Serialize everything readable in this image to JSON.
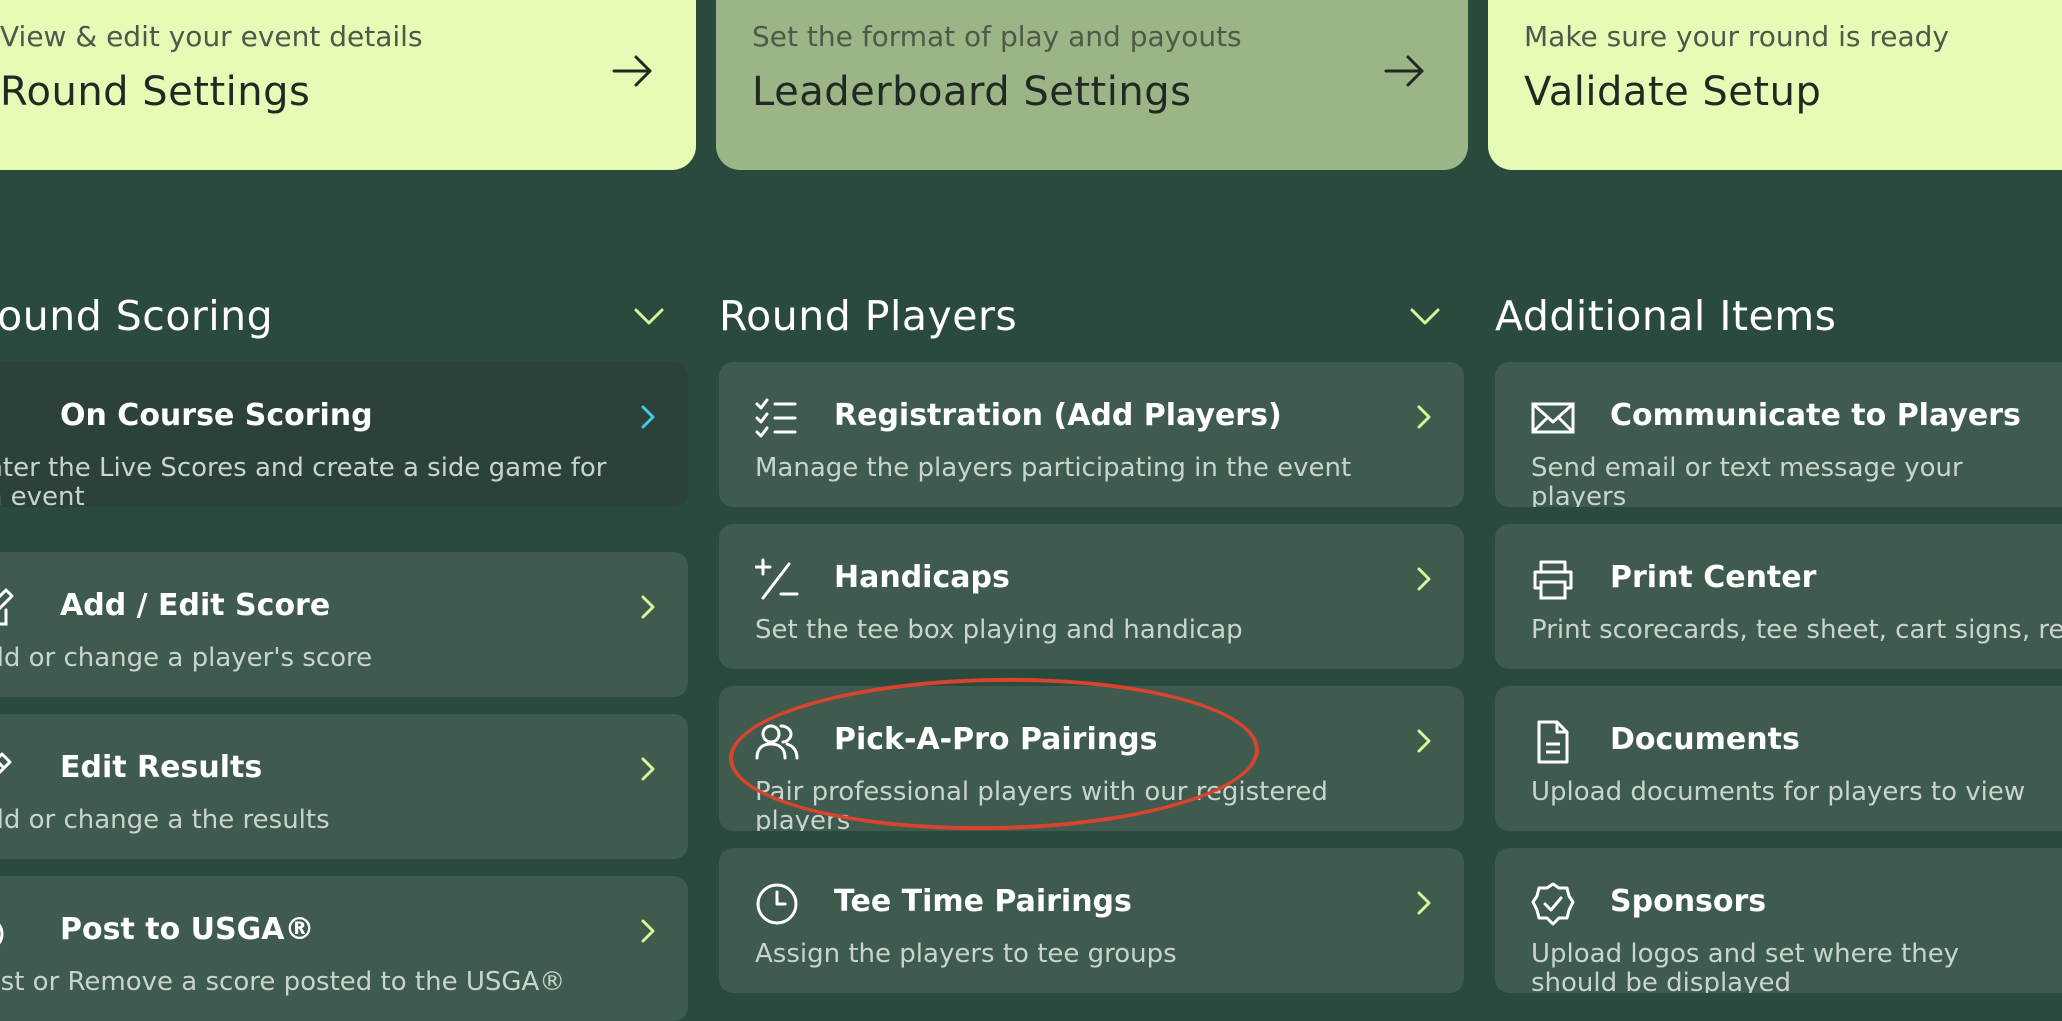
{
  "top_cards": [
    {
      "subtitle": "View & edit your event details",
      "title": "Round Settings"
    },
    {
      "subtitle": "Set the format of play and payouts",
      "title": "Leaderboard Settings"
    },
    {
      "subtitle": "Make sure your round is ready",
      "title": "Validate Setup"
    }
  ],
  "sections": [
    {
      "title": "Round Scoring",
      "items": [
        {
          "icon": "list-icon",
          "title": "On Course Scoring",
          "desc": "Enter the Live Scores and create a side game for an event"
        },
        {
          "icon": "edit-icon",
          "title": "Add / Edit Score",
          "desc": "Add or change a player's score"
        },
        {
          "icon": "pencil-icon",
          "title": "Edit Results",
          "desc": "Add or change a the results"
        },
        {
          "icon": "upload-icon",
          "title": "Post to USGA®",
          "desc": "Post or Remove a score posted to the USGA®"
        }
      ]
    },
    {
      "title": "Round Players",
      "items": [
        {
          "icon": "checklist-icon",
          "title": "Registration (Add Players)",
          "desc": "Manage the players participating in the event"
        },
        {
          "icon": "plus-minus-icon",
          "title": "Handicaps",
          "desc": "Set the tee box playing and handicap"
        },
        {
          "icon": "users-icon",
          "title": "Pick-A-Pro Pairings",
          "desc": "Pair professional players with our registered players"
        },
        {
          "icon": "clock-icon",
          "title": "Tee Time Pairings",
          "desc": "Assign the players to tee groups"
        }
      ]
    },
    {
      "title": "Additional Items",
      "items": [
        {
          "icon": "mail-icon",
          "title": "Communicate to Players",
          "desc": "Send email or text message your players"
        },
        {
          "icon": "printer-icon",
          "title": "Print Center",
          "desc": "Print scorecards, tee sheet, cart signs, results"
        },
        {
          "icon": "document-icon",
          "title": "Documents",
          "desc": "Upload documents for players to view"
        },
        {
          "icon": "badge-check-icon",
          "title": "Sponsors",
          "desc": "Upload logos and set where they should be displayed"
        }
      ]
    }
  ],
  "colors": {
    "accent": "#d8f59a",
    "highlight": "#d9442e",
    "background": "#2b4a3e"
  }
}
